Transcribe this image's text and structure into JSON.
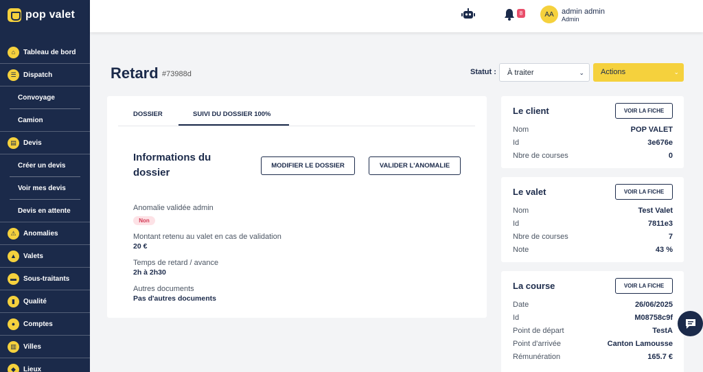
{
  "brand": {
    "name": "pop valet"
  },
  "sidebar": {
    "items": [
      {
        "label": "Tableau de bord",
        "icon": "home-icon",
        "glyph": "⌂"
      },
      {
        "label": "Dispatch",
        "icon": "list-icon",
        "glyph": "☰"
      },
      {
        "label": "Convoyage",
        "sub": true
      },
      {
        "label": "Camion",
        "sub": true,
        "last": true
      },
      {
        "label": "Devis",
        "icon": "document-icon",
        "glyph": "▤"
      },
      {
        "label": "Créer un devis",
        "sub": true
      },
      {
        "label": "Voir mes devis",
        "sub": true
      },
      {
        "label": "Devis en attente",
        "sub": true,
        "last": true
      },
      {
        "label": "Anomalies",
        "icon": "warning-icon",
        "glyph": "⚠"
      },
      {
        "label": "Valets",
        "icon": "car-icon",
        "glyph": "▲"
      },
      {
        "label": "Sous-traitants",
        "icon": "truck-icon",
        "glyph": "▬"
      },
      {
        "label": "Qualité",
        "icon": "clipboard-icon",
        "glyph": "▮"
      },
      {
        "label": "Comptes",
        "icon": "users-icon",
        "glyph": "●"
      },
      {
        "label": "Villes",
        "icon": "city-icon",
        "glyph": "▥"
      },
      {
        "label": "Lieux",
        "icon": "pin-icon",
        "glyph": "◆"
      }
    ]
  },
  "topbar": {
    "notification_count": "8",
    "avatar_initials": "AA",
    "user_name": "admin admin",
    "user_role": "Admin"
  },
  "page": {
    "title": "Retard",
    "reference": "#73988d",
    "statut_label": "Statut :",
    "statut_value": "À traiter",
    "actions_label": "Actions"
  },
  "tabs": [
    {
      "label": "DOSSIER"
    },
    {
      "label": "SUIVI DU DOSSIER 100%"
    }
  ],
  "dossier": {
    "section_title": "Informations du dossier",
    "modify_button": "MODIFIER LE DOSSIER",
    "validate_button": "VALIDER L'ANOMALIE",
    "fields": [
      {
        "label": "Anomalie validée admin",
        "value": "Non"
      },
      {
        "label": "Montant retenu au valet en cas de validation",
        "value": "20 €"
      },
      {
        "label": "Temps de retard / avance",
        "value": "2h à 2h30"
      },
      {
        "label": "Autres documents",
        "value": "Pas d'autres documents"
      }
    ]
  },
  "client_card": {
    "title": "Le client",
    "button": "VOIR LA FICHE",
    "rows": [
      {
        "label": "Nom",
        "value": "POP VALET"
      },
      {
        "label": "Id",
        "value": "3e676e"
      },
      {
        "label": "Nbre de courses",
        "value": "0"
      }
    ]
  },
  "valet_card": {
    "title": "Le valet",
    "button": "VOIR LA FICHE",
    "rows": [
      {
        "label": "Nom",
        "value": "Test Valet"
      },
      {
        "label": "Id",
        "value": "7811e3"
      },
      {
        "label": "Nbre de courses",
        "value": "7"
      },
      {
        "label": "Note",
        "value": "43 %"
      }
    ]
  },
  "course_card": {
    "title": "La course",
    "button": "VOIR LA FICHE",
    "rows": [
      {
        "label": "Date",
        "value": "26/06/2025"
      },
      {
        "label": "Id",
        "value": "M08758c9f"
      },
      {
        "label": "Point de départ",
        "value": "TestA"
      },
      {
        "label": "Point d'arrivée",
        "value": "Canton Lamousse"
      },
      {
        "label": "Rémunération",
        "value": "165.7 €"
      }
    ]
  },
  "colors": {
    "navy": "#1b2a4a",
    "yellow": "#f5d13d",
    "badge": "#e94e6a",
    "background": "#f3f4f6"
  }
}
